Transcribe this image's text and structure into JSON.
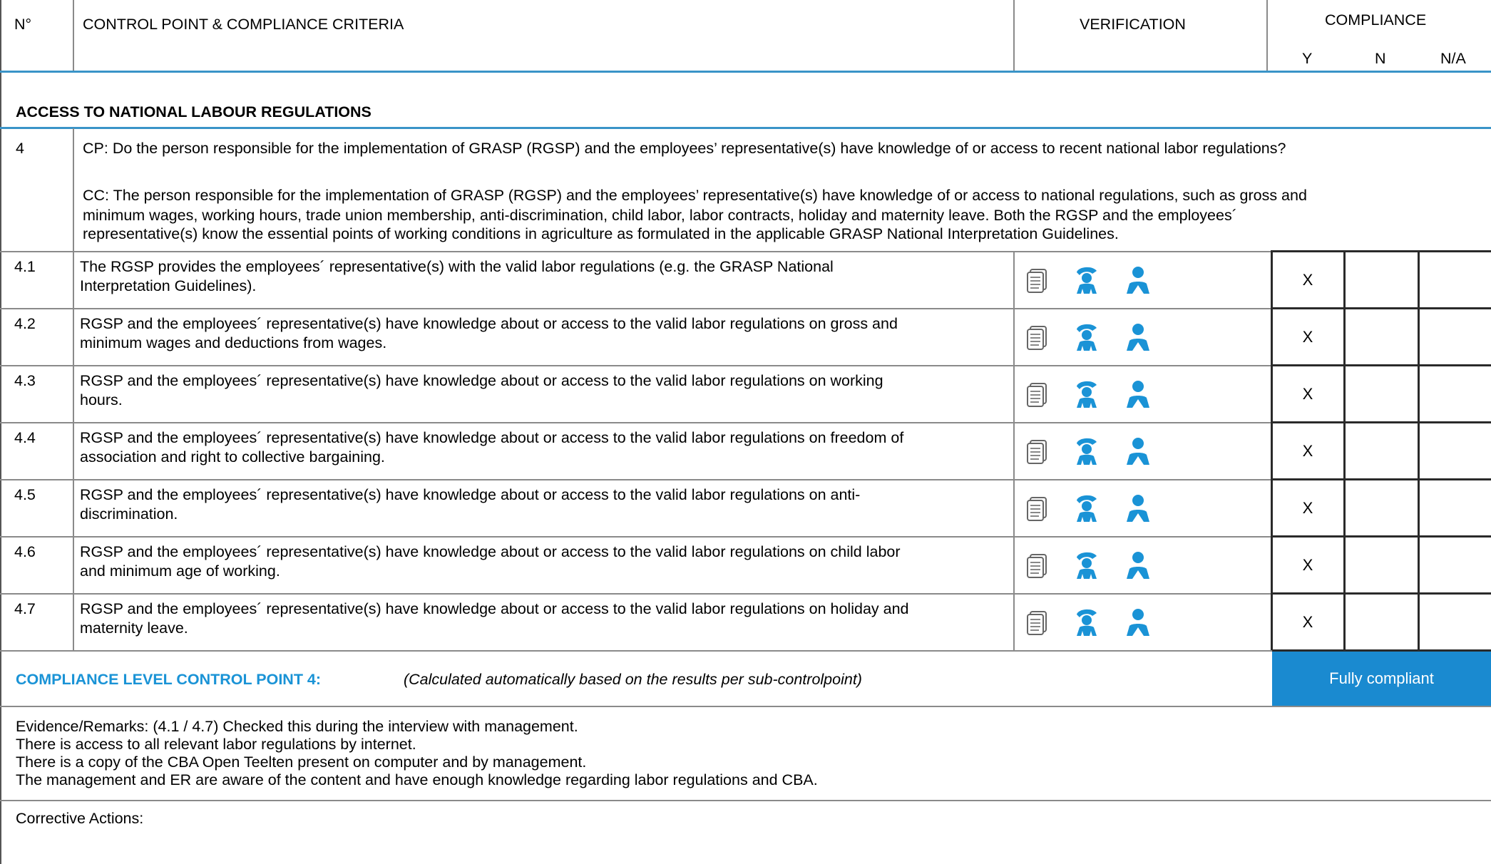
{
  "header": {
    "no": "N°",
    "control": "CONTROL POINT & COMPLIANCE CRITERIA",
    "verification": "VERIFICATION",
    "compliance": "COMPLIANCE",
    "y": "Y",
    "n": "N",
    "na": "N/A"
  },
  "section_title": "ACCESS TO NATIONAL LABOUR REGULATIONS",
  "control_point": {
    "no": "4",
    "cp": "CP: Do the person responsible for the implementation of GRASP (RGSP) and the employees’ representative(s) have knowledge of or access to recent national labor regulations?",
    "cc_lines": [
      "CC: The person responsible for the implementation of GRASP (RGSP) and the employees’ representative(s) have knowledge of or access to national regulations, such as gross and",
      "minimum wages, working hours, trade union membership, anti-discrimination, child labor, labor contracts, holiday and maternity leave. Both the RGSP and the employees´",
      "representative(s) know the essential points of working conditions in agriculture as formulated in the applicable GRASP National Interpretation Guidelines."
    ]
  },
  "rows": [
    {
      "no": "4.1",
      "line1": "The RGSP provides the employees´ representative(s) with the valid labor regulations (e.g. the GRASP National",
      "line2": "Interpretation Guidelines).",
      "y": "X",
      "n": "",
      "na": ""
    },
    {
      "no": "4.2",
      "line1": "RGSP and the employees´ representative(s) have knowledge about or access to the valid labor regulations on gross and",
      "line2": "minimum wages and deductions from wages.",
      "y": "X",
      "n": "",
      "na": ""
    },
    {
      "no": "4.3",
      "line1": "RGSP and the employees´ representative(s) have knowledge about or access to the valid labor regulations on working",
      "line2": "hours.",
      "y": "X",
      "n": "",
      "na": ""
    },
    {
      "no": "4.4",
      "line1": "RGSP and the employees´ representative(s) have knowledge about or access to the valid labor regulations on freedom of",
      "line2": "association and right to collective bargaining.",
      "y": "X",
      "n": "",
      "na": ""
    },
    {
      "no": "4.5",
      "line1": "RGSP and the employees´ representative(s) have knowledge about or access to the valid labor regulations on anti-",
      "line2": "discrimination.",
      "y": "X",
      "n": "",
      "na": ""
    },
    {
      "no": "4.6",
      "line1": "RGSP and the employees´ representative(s) have knowledge about or access to the valid labor regulations on child labor",
      "line2": "and minimum age of working.",
      "y": "X",
      "n": "",
      "na": ""
    },
    {
      "no": "4.7",
      "line1": "RGSP and the employees´ representative(s) have knowledge about or access to the valid labor regulations on holiday and",
      "line2": "maternity leave.",
      "y": "X",
      "n": "",
      "na": ""
    }
  ],
  "compliance_level": {
    "label": "COMPLIANCE LEVEL CONTROL POINT 4:",
    "note": "(Calculated automatically based on the results per sub-controlpoint)",
    "status": "Fully compliant",
    "status_color": "#1a8ad0"
  },
  "remarks": [
    "Evidence/Remarks: (4.1 / 4.7) Checked this during the interview with  management.",
    "There is access to all relevant labor regulations by internet.",
    "There is a copy of the CBA Open Teelten present on computer and by management.",
    "The management and ER are aware of the content and have enough knowledge regarding labor regulations and CBA."
  ],
  "corrective_actions": "Corrective Actions:",
  "verification_icons": [
    "document-icon",
    "worker-icon",
    "person-icon"
  ],
  "accent_color": "#1a93d6"
}
